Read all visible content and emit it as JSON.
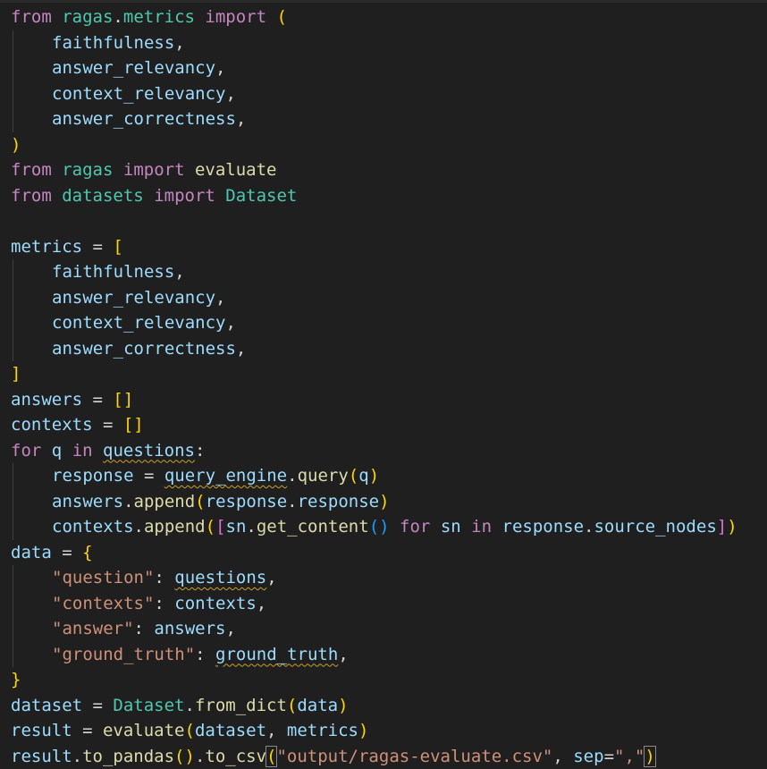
{
  "editor": {
    "lines": [
      [
        [
          "kw",
          "from"
        ],
        [
          "op",
          " "
        ],
        [
          "mod",
          "ragas"
        ],
        [
          "op",
          "."
        ],
        [
          "mod",
          "metrics"
        ],
        [
          "op",
          " "
        ],
        [
          "kw",
          "import"
        ],
        [
          "op",
          " "
        ],
        [
          "b1",
          "("
        ]
      ],
      [
        [
          "ind",
          ""
        ],
        [
          "var",
          "faithfulness"
        ],
        [
          "op",
          ","
        ]
      ],
      [
        [
          "ind",
          ""
        ],
        [
          "var",
          "answer_relevancy"
        ],
        [
          "op",
          ","
        ]
      ],
      [
        [
          "ind",
          ""
        ],
        [
          "var",
          "context_relevancy"
        ],
        [
          "op",
          ","
        ]
      ],
      [
        [
          "ind",
          ""
        ],
        [
          "var",
          "answer_correctness"
        ],
        [
          "op",
          ","
        ]
      ],
      [
        [
          "b1",
          ")"
        ]
      ],
      [
        [
          "kw",
          "from"
        ],
        [
          "op",
          " "
        ],
        [
          "mod",
          "ragas"
        ],
        [
          "op",
          " "
        ],
        [
          "kw",
          "import"
        ],
        [
          "op",
          " "
        ],
        [
          "fn",
          "evaluate"
        ]
      ],
      [
        [
          "kw",
          "from"
        ],
        [
          "op",
          " "
        ],
        [
          "mod",
          "datasets"
        ],
        [
          "op",
          " "
        ],
        [
          "kw",
          "import"
        ],
        [
          "op",
          " "
        ],
        [
          "cls",
          "Dataset"
        ]
      ],
      [],
      [
        [
          "var",
          "metrics"
        ],
        [
          "op",
          " = "
        ],
        [
          "b1",
          "["
        ]
      ],
      [
        [
          "ind",
          ""
        ],
        [
          "var",
          "faithfulness"
        ],
        [
          "op",
          ","
        ]
      ],
      [
        [
          "ind",
          ""
        ],
        [
          "var",
          "answer_relevancy"
        ],
        [
          "op",
          ","
        ]
      ],
      [
        [
          "ind",
          ""
        ],
        [
          "var",
          "context_relevancy"
        ],
        [
          "op",
          ","
        ]
      ],
      [
        [
          "ind",
          ""
        ],
        [
          "var",
          "answer_correctness"
        ],
        [
          "op",
          ","
        ]
      ],
      [
        [
          "b1",
          "]"
        ]
      ],
      [
        [
          "var",
          "answers"
        ],
        [
          "op",
          " = "
        ],
        [
          "b1",
          "[]"
        ]
      ],
      [
        [
          "var",
          "contexts"
        ],
        [
          "op",
          " = "
        ],
        [
          "b1",
          "[]"
        ]
      ],
      [
        [
          "kw",
          "for"
        ],
        [
          "op",
          " "
        ],
        [
          "var",
          "q"
        ],
        [
          "op",
          " "
        ],
        [
          "kw",
          "in"
        ],
        [
          "op",
          " "
        ],
        [
          "var squig",
          "questions"
        ],
        [
          "op",
          ":"
        ]
      ],
      [
        [
          "ind",
          ""
        ],
        [
          "var",
          "response"
        ],
        [
          "op",
          " = "
        ],
        [
          "var squig",
          "query_engine"
        ],
        [
          "op",
          "."
        ],
        [
          "fn",
          "query"
        ],
        [
          "b1",
          "("
        ],
        [
          "var",
          "q"
        ],
        [
          "b1",
          ")"
        ]
      ],
      [
        [
          "ind",
          ""
        ],
        [
          "var",
          "answers"
        ],
        [
          "op",
          "."
        ],
        [
          "fn",
          "append"
        ],
        [
          "b1",
          "("
        ],
        [
          "var",
          "response"
        ],
        [
          "op",
          "."
        ],
        [
          "var",
          "response"
        ],
        [
          "b1",
          ")"
        ]
      ],
      [
        [
          "ind",
          ""
        ],
        [
          "var",
          "contexts"
        ],
        [
          "op",
          "."
        ],
        [
          "fn",
          "append"
        ],
        [
          "b1",
          "("
        ],
        [
          "b2",
          "["
        ],
        [
          "var",
          "sn"
        ],
        [
          "op",
          "."
        ],
        [
          "fn",
          "get_content"
        ],
        [
          "b3",
          "()"
        ],
        [
          "op",
          " "
        ],
        [
          "kw",
          "for"
        ],
        [
          "op",
          " "
        ],
        [
          "var",
          "sn"
        ],
        [
          "op",
          " "
        ],
        [
          "kw",
          "in"
        ],
        [
          "op",
          " "
        ],
        [
          "var",
          "response"
        ],
        [
          "op",
          "."
        ],
        [
          "var",
          "source_nodes"
        ],
        [
          "b2",
          "]"
        ],
        [
          "b1",
          ")"
        ]
      ],
      [
        [
          "var",
          "data"
        ],
        [
          "op",
          " = "
        ],
        [
          "b1",
          "{"
        ]
      ],
      [
        [
          "ind",
          ""
        ],
        [
          "str",
          "\"question\""
        ],
        [
          "op",
          ": "
        ],
        [
          "var squig",
          "questions"
        ],
        [
          "op",
          ","
        ]
      ],
      [
        [
          "ind",
          ""
        ],
        [
          "str",
          "\"contexts\""
        ],
        [
          "op",
          ": "
        ],
        [
          "var",
          "contexts"
        ],
        [
          "op",
          ","
        ]
      ],
      [
        [
          "ind",
          ""
        ],
        [
          "str",
          "\"answer\""
        ],
        [
          "op",
          ": "
        ],
        [
          "var",
          "answers"
        ],
        [
          "op",
          ","
        ]
      ],
      [
        [
          "ind",
          ""
        ],
        [
          "str",
          "\"ground_truth\""
        ],
        [
          "op",
          ": "
        ],
        [
          "var squig",
          "ground_truth"
        ],
        [
          "op",
          ","
        ]
      ],
      [
        [
          "b1",
          "}"
        ]
      ],
      [
        [
          "var",
          "dataset"
        ],
        [
          "op",
          " = "
        ],
        [
          "cls",
          "Dataset"
        ],
        [
          "op",
          "."
        ],
        [
          "fn",
          "from_dict"
        ],
        [
          "b1",
          "("
        ],
        [
          "var",
          "data"
        ],
        [
          "b1",
          ")"
        ]
      ],
      [
        [
          "var",
          "result"
        ],
        [
          "op",
          " = "
        ],
        [
          "fn",
          "evaluate"
        ],
        [
          "b1",
          "("
        ],
        [
          "var",
          "dataset"
        ],
        [
          "op",
          ", "
        ],
        [
          "var",
          "metrics"
        ],
        [
          "b1",
          ")"
        ]
      ],
      [
        [
          "var",
          "result"
        ],
        [
          "op",
          "."
        ],
        [
          "fn",
          "to_pandas"
        ],
        [
          "b1",
          "()"
        ],
        [
          "op",
          "."
        ],
        [
          "fn",
          "to_csv"
        ],
        [
          "b1 match",
          "("
        ],
        [
          "str",
          "\"output/ragas-evaluate.csv\""
        ],
        [
          "op",
          ", "
        ],
        [
          "var",
          "sep"
        ],
        [
          "op",
          "="
        ],
        [
          "str",
          "\",\""
        ],
        [
          "b1 match",
          ")"
        ]
      ]
    ]
  }
}
